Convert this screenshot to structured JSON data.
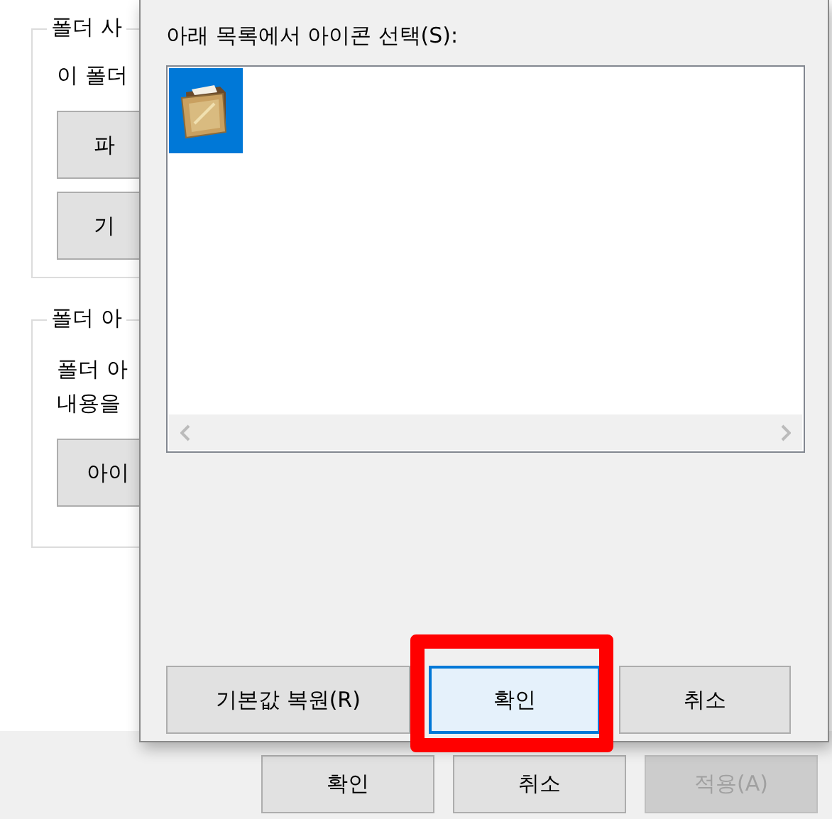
{
  "background_window": {
    "groups": [
      {
        "title": "폴더 사",
        "texts": [
          "이 폴더"
        ],
        "buttons": [
          "파",
          "기"
        ]
      },
      {
        "title": "폴더 아",
        "texts": [
          "폴더 아",
          "내용을"
        ],
        "buttons": [
          "아이"
        ]
      }
    ],
    "buttons": [
      {
        "label": "확인",
        "disabled": false
      },
      {
        "label": "취소",
        "disabled": false
      },
      {
        "label": "적용(A)",
        "disabled": true
      }
    ]
  },
  "dialog": {
    "label": "아래 목록에서 아이콘 선택(S):",
    "icons": [
      {
        "selected": true
      }
    ],
    "buttons": [
      {
        "label": "기본값 복원(R)",
        "default": false,
        "highlighted": false
      },
      {
        "label": "확인",
        "default": true,
        "highlighted": true
      },
      {
        "label": "취소",
        "default": false,
        "highlighted": false
      }
    ]
  }
}
